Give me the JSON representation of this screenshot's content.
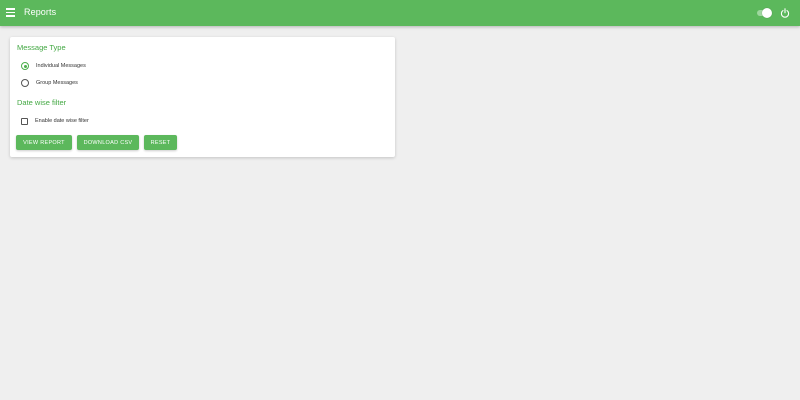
{
  "header": {
    "title": "Reports",
    "menu_icon": "menu-icon",
    "toggle_icon": "toggle-switch",
    "power_icon": "power-icon",
    "accent_color": "#5cb85c"
  },
  "message_type": {
    "title": "Message Type",
    "options": [
      {
        "label": "Individual Messages",
        "selected": true
      },
      {
        "label": "Group Messages",
        "selected": false
      }
    ]
  },
  "date_filter": {
    "title": "Date wise filter",
    "checkbox_label": "Enable date wise filter",
    "checked": false
  },
  "actions": {
    "view_report": "VIEW REPORT",
    "download_csv": "DOWNLOAD CSV",
    "reset": "RESET"
  }
}
